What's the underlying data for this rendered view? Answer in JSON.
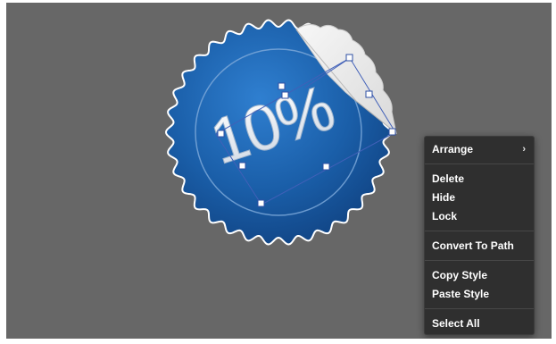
{
  "canvas": {
    "background": "#676767"
  },
  "badge": {
    "label": "10%",
    "fill_color": "#1a5ea8",
    "peel_color": "#ebebeb",
    "selection_color": "#3a5bb5"
  },
  "context_menu": {
    "items": [
      {
        "label": "Arrange",
        "submenu": true,
        "submenu_icon": "chevron-right-icon"
      },
      {
        "label": "Delete"
      },
      {
        "label": "Hide"
      },
      {
        "label": "Lock"
      },
      {
        "label": "Convert To Path"
      },
      {
        "label": "Copy Style"
      },
      {
        "label": "Paste Style"
      },
      {
        "label": "Select All"
      }
    ]
  }
}
